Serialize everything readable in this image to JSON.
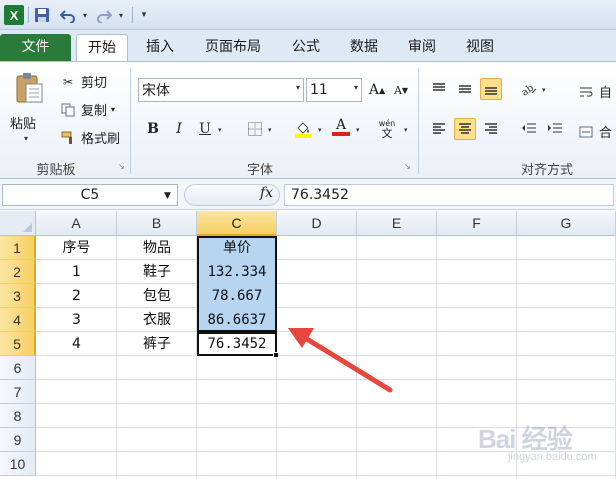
{
  "app": {
    "logo_letter": "X"
  },
  "quick_access": {
    "undo_dropdown": "▾",
    "redo_dropdown": "▾",
    "customize": "▾"
  },
  "tabs": [
    {
      "label": "文件"
    },
    {
      "label": "开始"
    },
    {
      "label": "插入"
    },
    {
      "label": "页面布局"
    },
    {
      "label": "公式"
    },
    {
      "label": "数据"
    },
    {
      "label": "审阅"
    },
    {
      "label": "视图"
    }
  ],
  "active_tab": "开始",
  "ribbon": {
    "clipboard": {
      "paste": "粘贴",
      "cut": "剪切",
      "copy": "复制",
      "format_painter": "格式刷",
      "group_label": "剪贴板"
    },
    "font": {
      "font_name": "宋体",
      "font_size": "11",
      "bold": "B",
      "italic": "I",
      "underline": "U",
      "font_color_letter": "A",
      "phonetic": "wén",
      "group_label": "字体"
    },
    "alignment": {
      "group_label": "对齐方式",
      "wrap_fragment": "自",
      "merge_fragment": "合"
    }
  },
  "formula_bar": {
    "name_box": "C5",
    "fx": "fx",
    "formula": "76.3452"
  },
  "sheet": {
    "columns": [
      "A",
      "B",
      "C",
      "D",
      "E",
      "F",
      "G"
    ],
    "rows": [
      "1",
      "2",
      "3",
      "4",
      "5",
      "6",
      "7",
      "8",
      "9",
      "10"
    ],
    "active_column": "C",
    "cells": [
      {
        "col": "A",
        "row": 1,
        "value": "序号"
      },
      {
        "col": "B",
        "row": 1,
        "value": "物品"
      },
      {
        "col": "C",
        "row": 1,
        "value": "单价"
      },
      {
        "col": "A",
        "row": 2,
        "value": "1"
      },
      {
        "col": "B",
        "row": 2,
        "value": "鞋子"
      },
      {
        "col": "C",
        "row": 2,
        "value": "132.334"
      },
      {
        "col": "A",
        "row": 3,
        "value": "2"
      },
      {
        "col": "B",
        "row": 3,
        "value": "包包"
      },
      {
        "col": "C",
        "row": 3,
        "value": "78.667"
      },
      {
        "col": "A",
        "row": 4,
        "value": "3"
      },
      {
        "col": "B",
        "row": 4,
        "value": "衣服"
      },
      {
        "col": "C",
        "row": 4,
        "value": "86.6637"
      },
      {
        "col": "A",
        "row": 5,
        "value": "4"
      },
      {
        "col": "B",
        "row": 5,
        "value": "裤子"
      },
      {
        "col": "C",
        "row": 5,
        "value": "76.3452"
      }
    ]
  },
  "colors": {
    "file_tab": "#2a7a3a",
    "selection_fill": "#b7d4f0",
    "active_header": "#f7cf62",
    "annotation_arrow": "#e8453c"
  },
  "watermark": {
    "main": "Bai 经验",
    "sub": "jingyan.baidu.com"
  }
}
